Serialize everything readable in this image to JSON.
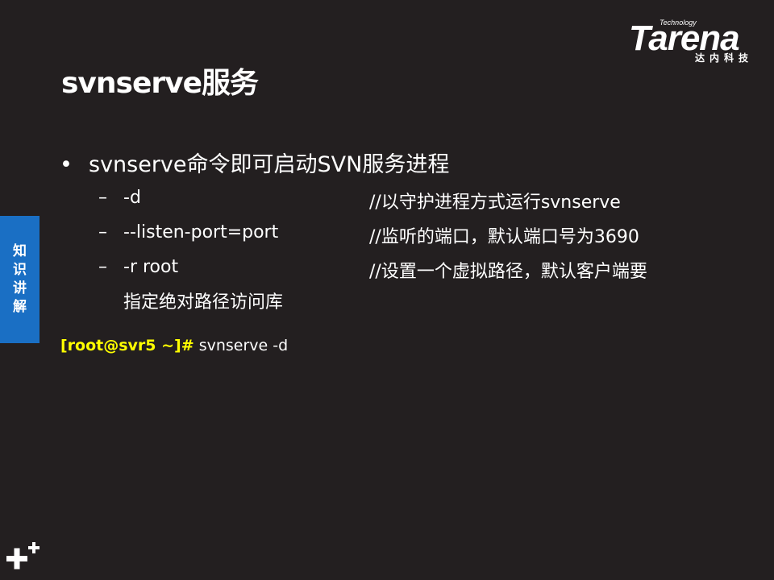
{
  "logo": {
    "technology": "Technology",
    "brand": "Tarena",
    "subtitle": "达内科技"
  },
  "slide": {
    "title": "svnserve服务",
    "bullet": "svnserve命令即可启动SVN服务进程",
    "options": [
      {
        "dash": "–",
        "option": "-d",
        "comment": "//以守护进程方式运行svnserve"
      },
      {
        "dash": "–",
        "option": "--listen-port=port",
        "comment": "//监听的端口，默认端口号为3690"
      },
      {
        "dash": "–",
        "option": "-r root",
        "comment": "//设置一个虚拟路径，默认客户端要"
      }
    ],
    "option_continuation": "指定绝对路径访问库",
    "command": {
      "prompt": "[root@svr5 ~]#",
      "text": " svnserve -d"
    }
  },
  "side_tab": [
    "知",
    "识",
    "讲",
    "解"
  ],
  "colors": {
    "background": "#231f20",
    "prompt": "#ffff00",
    "side_tab": "#1a6fc4"
  }
}
